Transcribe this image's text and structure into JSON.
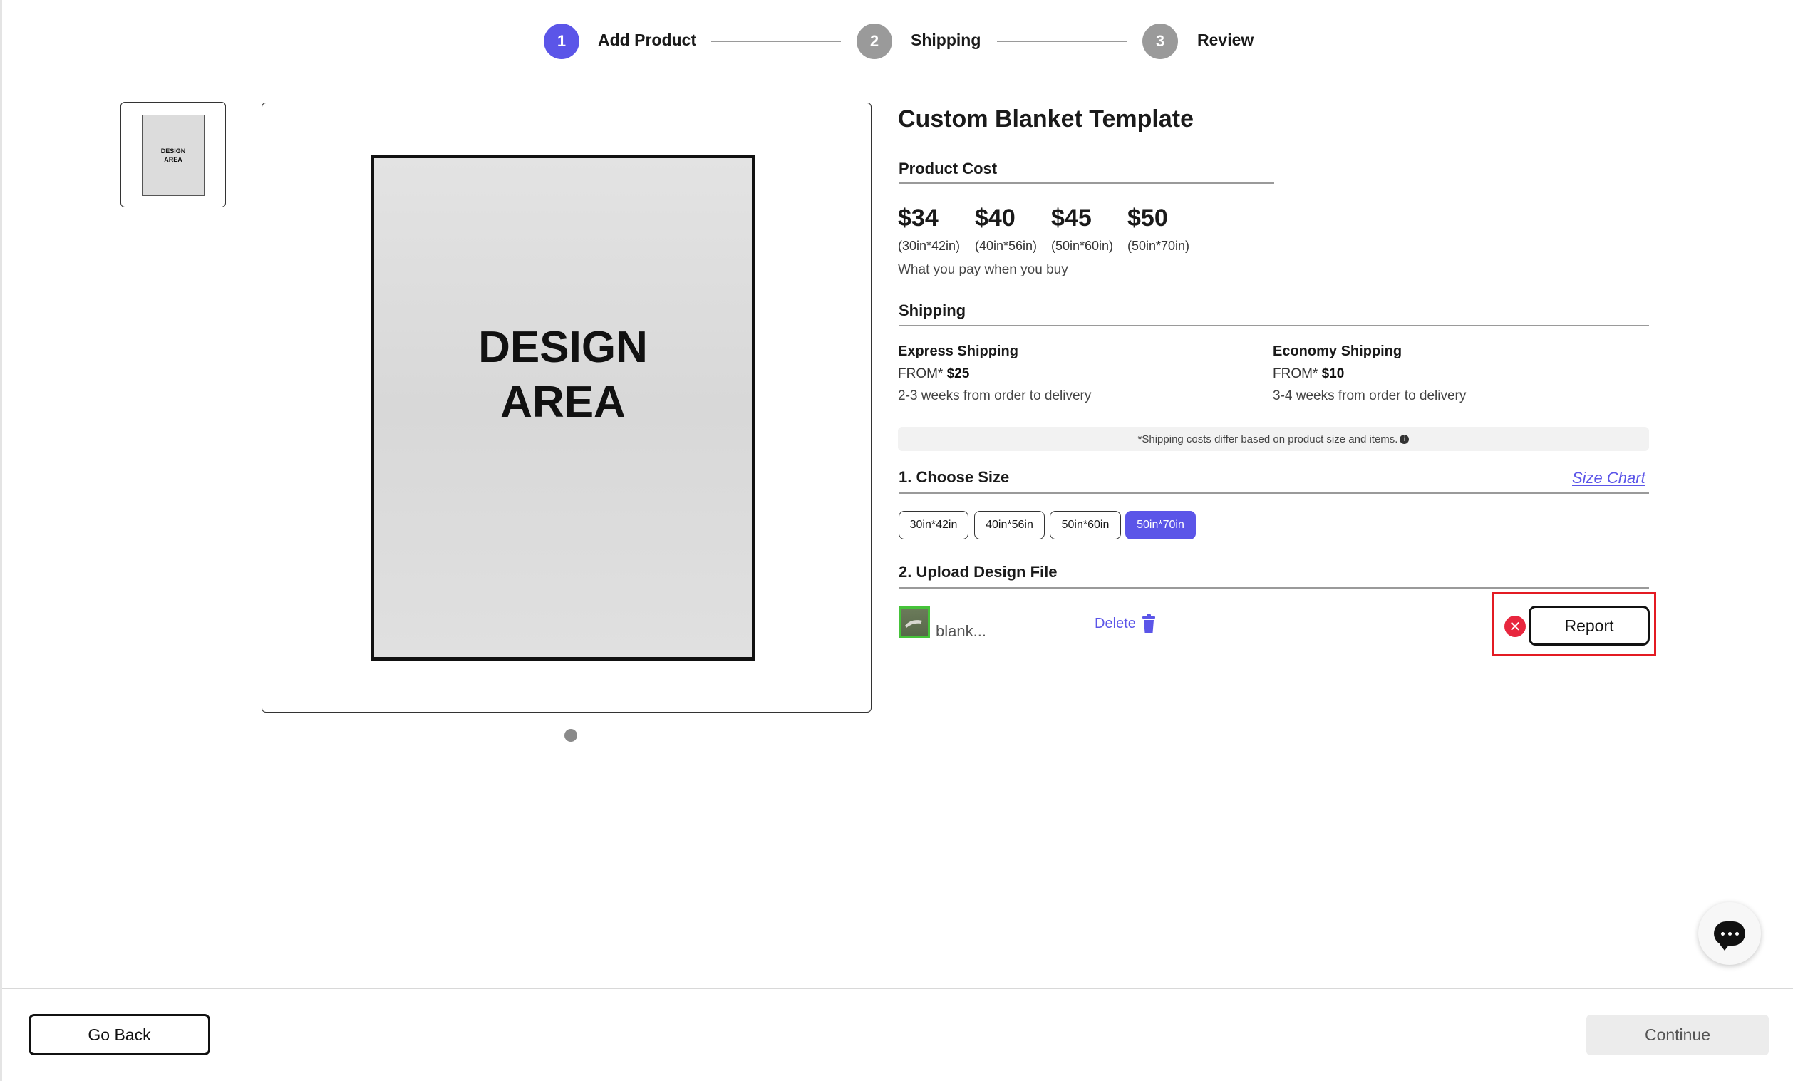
{
  "stepper": {
    "steps": [
      {
        "number": "1",
        "label": "Add Product",
        "active": true
      },
      {
        "number": "2",
        "label": "Shipping",
        "active": false
      },
      {
        "number": "3",
        "label": "Review",
        "active": false
      }
    ]
  },
  "gallery": {
    "thumbnail_text": "DESIGN AREA",
    "preview_line1": "DESIGN",
    "preview_line2": "AREA",
    "slide_count": 1,
    "current_slide": 1
  },
  "product": {
    "title": "Custom Blanket Template",
    "cost_heading": "Product Cost",
    "prices": [
      {
        "price": "$34",
        "size": "(30in*42in)"
      },
      {
        "price": "$40",
        "size": "(40in*56in)"
      },
      {
        "price": "$45",
        "size": "(50in*60in)"
      },
      {
        "price": "$50",
        "size": "(50in*70in)"
      }
    ],
    "pay_note": "What you pay when you buy"
  },
  "shipping": {
    "heading": "Shipping",
    "express": {
      "name": "Express Shipping",
      "from_label": "FROM*",
      "price": "$25",
      "time": "2-3 weeks from order to delivery"
    },
    "economy": {
      "name": "Economy Shipping",
      "from_label": "FROM*",
      "price": "$10",
      "time": "3-4 weeks from order to delivery"
    },
    "note": "*Shipping costs differ based on product size and items."
  },
  "size_select": {
    "heading": "1. Choose Size",
    "size_chart_link": "Size Chart",
    "options": [
      "30in*42in",
      "40in*56in",
      "50in*60in",
      "50in*70in"
    ],
    "selected": "50in*70in"
  },
  "upload": {
    "heading": "2. Upload Design File",
    "file_name": "blank...",
    "delete_label": "Delete",
    "report_label": "Report"
  },
  "footer": {
    "back_label": "Go Back",
    "continue_label": "Continue"
  },
  "colors": {
    "accent": "#5b55e8",
    "step_inactive": "#9a9a9a",
    "error": "#e8263e",
    "highlight_border": "#e31b23"
  }
}
